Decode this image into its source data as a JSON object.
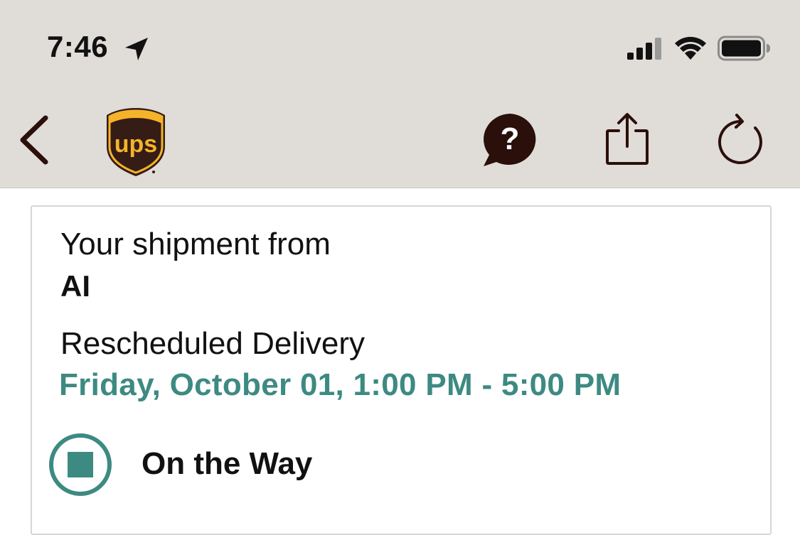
{
  "status_bar": {
    "time": "7:46",
    "icons": [
      "location-arrow-icon",
      "signal-icon",
      "wifi-icon",
      "battery-icon"
    ]
  },
  "nav": {
    "back_icon": "chevron-left-icon",
    "logo_text": "ups",
    "help_icon": "help-bubble-icon",
    "help_glyph": "?",
    "share_icon": "share-icon",
    "refresh_icon": "refresh-icon"
  },
  "shipment": {
    "from_label": "Your shipment from",
    "sender": "AI",
    "delivery_label": "Rescheduled Delivery",
    "delivery_window": "Friday, October 01, 1:00 PM - 5:00 PM",
    "status": "On the Way"
  },
  "colors": {
    "bar_bg": "#e0ddd8",
    "brand_brown": "#2b0f0a",
    "ups_gold": "#f5b32a",
    "accent_teal": "#3d8a82"
  }
}
